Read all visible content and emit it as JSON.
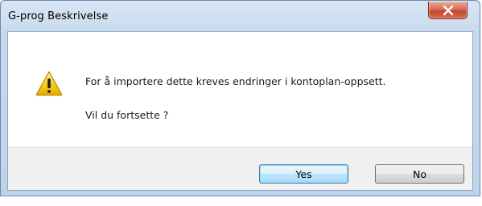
{
  "window": {
    "title": "G-prog Beskrivelse"
  },
  "dialog": {
    "message": "For å importere dette kreves endringer i kontoplan-oppsett.",
    "question": "Vil du fortsette ?",
    "icon": "warning-icon"
  },
  "buttons": {
    "yes_label": "Yes",
    "no_label": "No",
    "close_icon": "close-icon"
  },
  "colors": {
    "title_bar": "#bed3ea",
    "close_button": "#c74630",
    "warning_yellow": "#f5c400",
    "default_button": "#bee6fd"
  }
}
